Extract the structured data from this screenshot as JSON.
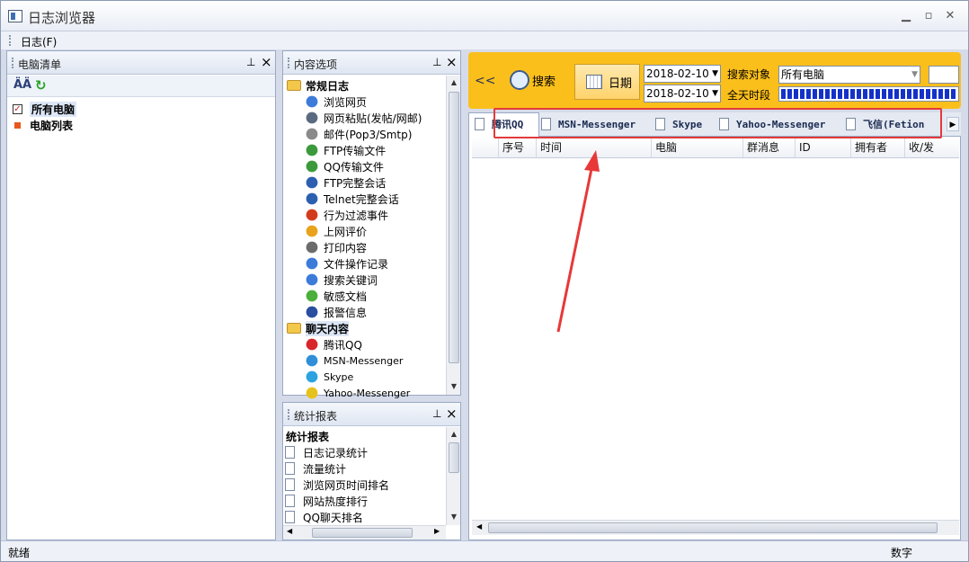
{
  "window": {
    "title": "日志浏览器"
  },
  "menu": {
    "log": "日志(F)"
  },
  "computer_pane": {
    "title": "电脑清单",
    "items": [
      {
        "label": "所有电脑",
        "checked": true
      },
      {
        "label": "电脑列表"
      }
    ]
  },
  "content_pane": {
    "title": "内容选项",
    "groups": [
      {
        "label": "常规日志",
        "items": [
          "浏览网页",
          "网页粘贴(发帖/网邮)",
          "邮件(Pop3/Smtp)",
          "FTP传输文件",
          "QQ传输文件",
          "FTP完整会话",
          "Telnet完整会话",
          "行为过滤事件",
          "上网评价",
          "打印内容",
          "文件操作记录",
          "搜索关键词",
          "敏感文档",
          "报警信息"
        ]
      },
      {
        "label": "聊天内容",
        "items": [
          "腾讯QQ",
          "MSN-Messenger",
          "Skype",
          "Yahoo-Messenger"
        ]
      }
    ]
  },
  "stats_pane": {
    "title": "统计报表",
    "header": "统计报表",
    "items": [
      "日志记录统计",
      "流量统计",
      "浏览网页时间排名",
      "网站热度排行",
      "QQ聊天排名"
    ]
  },
  "toolbar": {
    "collapse": "<<",
    "search": "搜索",
    "date": "日期",
    "date_from": "2018-02-10",
    "date_to": "2018-02-10",
    "search_target_label": "搜索对象",
    "search_target_value": "所有电脑",
    "all_day_label": "全天时段"
  },
  "tabs": [
    "腾讯QQ",
    "MSN-Messenger",
    "Skype",
    "Yahoo-Messenger",
    "飞信(Fetion"
  ],
  "table": {
    "columns": [
      "序号",
      "时间",
      "电脑",
      "群消息",
      "ID",
      "拥有者",
      "收/发"
    ]
  },
  "status": {
    "left": "就绪",
    "right": "数字"
  },
  "colors": {
    "toolbar_bg": "#fbbf1c",
    "highlight": "#e23a3a",
    "arrow": "#e83838",
    "progress": "#1432c8"
  }
}
